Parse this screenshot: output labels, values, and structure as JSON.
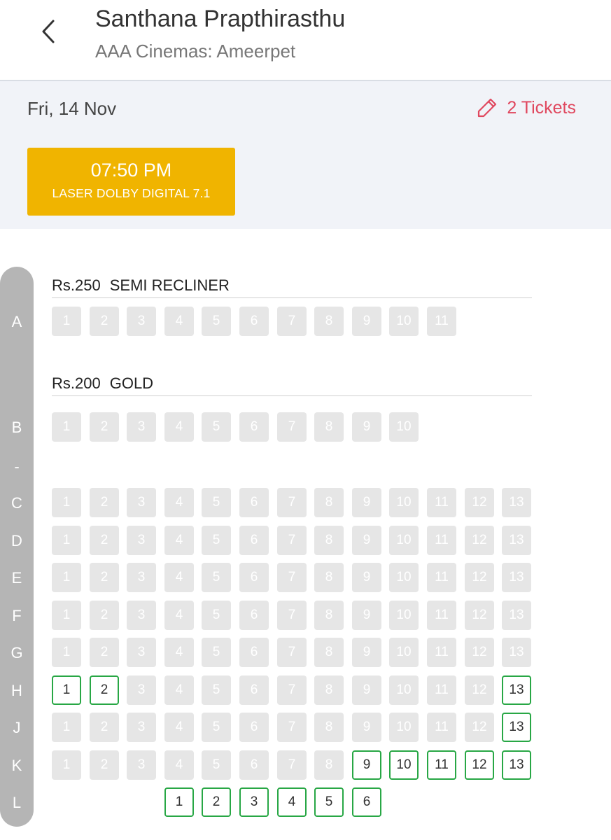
{
  "header": {
    "title": "Santhana Prapthirasthu",
    "subtitle": "AAA Cinemas: Ameerpet",
    "back_icon": "back-arrow-icon"
  },
  "booking": {
    "date": "Fri, 14 Nov",
    "tickets_label": "2 Tickets",
    "edit_icon": "pencil-icon",
    "showtime": {
      "time": "07:50 PM",
      "format": "LASER DOLBY DIGITAL 7.1"
    }
  },
  "colors": {
    "accent_red": "#e0475e",
    "showtime_bg": "#f0b400",
    "available_border": "#28a745",
    "unavailable_bg": "#e6e6e6"
  },
  "sections": [
    {
      "price": "Rs.250",
      "name": "SEMI RECLINER"
    },
    {
      "price": "Rs.200",
      "name": "GOLD"
    }
  ],
  "row_labels": [
    "A",
    "B",
    "-",
    "C",
    "D",
    "E",
    "F",
    "G",
    "H",
    "J",
    "K",
    "L"
  ],
  "seat_rows": [
    {
      "row": "A",
      "section": 0,
      "seats": [
        {
          "n": "1",
          "s": "u"
        },
        {
          "n": "2",
          "s": "u"
        },
        {
          "n": "3",
          "s": "u"
        },
        {
          "n": "4",
          "s": "u"
        },
        {
          "n": "5",
          "s": "u"
        },
        {
          "n": "6",
          "s": "u"
        },
        {
          "n": "7",
          "s": "u"
        },
        {
          "n": "8",
          "s": "u"
        },
        {
          "n": "9",
          "s": "u"
        },
        {
          "n": "10",
          "s": "u"
        },
        {
          "n": "11",
          "s": "u"
        }
      ]
    },
    {
      "row": "B",
      "section": 1,
      "seats": [
        {
          "n": "1",
          "s": "u"
        },
        {
          "n": "2",
          "s": "u"
        },
        {
          "n": "3",
          "s": "u"
        },
        {
          "n": "4",
          "s": "u"
        },
        {
          "n": "5",
          "s": "u"
        },
        {
          "n": "6",
          "s": "u"
        },
        {
          "n": "7",
          "s": "u"
        },
        {
          "n": "8",
          "s": "u"
        },
        {
          "n": "9",
          "s": "u"
        },
        {
          "n": "10",
          "s": "u"
        }
      ]
    },
    {
      "row": "C",
      "section": 1,
      "seats": [
        {
          "n": "1",
          "s": "u"
        },
        {
          "n": "2",
          "s": "u"
        },
        {
          "n": "3",
          "s": "u"
        },
        {
          "n": "4",
          "s": "u"
        },
        {
          "n": "5",
          "s": "u"
        },
        {
          "n": "6",
          "s": "u"
        },
        {
          "n": "7",
          "s": "u"
        },
        {
          "n": "8",
          "s": "u"
        },
        {
          "n": "9",
          "s": "u"
        },
        {
          "n": "10",
          "s": "u"
        },
        {
          "n": "11",
          "s": "u"
        },
        {
          "n": "12",
          "s": "u"
        },
        {
          "n": "13",
          "s": "u"
        }
      ]
    },
    {
      "row": "D",
      "section": 1,
      "seats": [
        {
          "n": "1",
          "s": "u"
        },
        {
          "n": "2",
          "s": "u"
        },
        {
          "n": "3",
          "s": "u"
        },
        {
          "n": "4",
          "s": "u"
        },
        {
          "n": "5",
          "s": "u"
        },
        {
          "n": "6",
          "s": "u"
        },
        {
          "n": "7",
          "s": "u"
        },
        {
          "n": "8",
          "s": "u"
        },
        {
          "n": "9",
          "s": "u"
        },
        {
          "n": "10",
          "s": "u"
        },
        {
          "n": "11",
          "s": "u"
        },
        {
          "n": "12",
          "s": "u"
        },
        {
          "n": "13",
          "s": "u"
        }
      ]
    },
    {
      "row": "E",
      "section": 1,
      "seats": [
        {
          "n": "1",
          "s": "u"
        },
        {
          "n": "2",
          "s": "u"
        },
        {
          "n": "3",
          "s": "u"
        },
        {
          "n": "4",
          "s": "u"
        },
        {
          "n": "5",
          "s": "u"
        },
        {
          "n": "6",
          "s": "u"
        },
        {
          "n": "7",
          "s": "u"
        },
        {
          "n": "8",
          "s": "u"
        },
        {
          "n": "9",
          "s": "u"
        },
        {
          "n": "10",
          "s": "u"
        },
        {
          "n": "11",
          "s": "u"
        },
        {
          "n": "12",
          "s": "u"
        },
        {
          "n": "13",
          "s": "u"
        }
      ]
    },
    {
      "row": "F",
      "section": 1,
      "seats": [
        {
          "n": "1",
          "s": "u"
        },
        {
          "n": "2",
          "s": "u"
        },
        {
          "n": "3",
          "s": "u"
        },
        {
          "n": "4",
          "s": "u"
        },
        {
          "n": "5",
          "s": "u"
        },
        {
          "n": "6",
          "s": "u"
        },
        {
          "n": "7",
          "s": "u"
        },
        {
          "n": "8",
          "s": "u"
        },
        {
          "n": "9",
          "s": "u"
        },
        {
          "n": "10",
          "s": "u"
        },
        {
          "n": "11",
          "s": "u"
        },
        {
          "n": "12",
          "s": "u"
        },
        {
          "n": "13",
          "s": "u"
        }
      ]
    },
    {
      "row": "G",
      "section": 1,
      "seats": [
        {
          "n": "1",
          "s": "u"
        },
        {
          "n": "2",
          "s": "u"
        },
        {
          "n": "3",
          "s": "u"
        },
        {
          "n": "4",
          "s": "u"
        },
        {
          "n": "5",
          "s": "u"
        },
        {
          "n": "6",
          "s": "u"
        },
        {
          "n": "7",
          "s": "u"
        },
        {
          "n": "8",
          "s": "u"
        },
        {
          "n": "9",
          "s": "u"
        },
        {
          "n": "10",
          "s": "u"
        },
        {
          "n": "11",
          "s": "u"
        },
        {
          "n": "12",
          "s": "u"
        },
        {
          "n": "13",
          "s": "u"
        }
      ]
    },
    {
      "row": "H",
      "section": 1,
      "seats": [
        {
          "n": "1",
          "s": "a"
        },
        {
          "n": "2",
          "s": "a"
        },
        {
          "n": "3",
          "s": "u"
        },
        {
          "n": "4",
          "s": "u"
        },
        {
          "n": "5",
          "s": "u"
        },
        {
          "n": "6",
          "s": "u"
        },
        {
          "n": "7",
          "s": "u"
        },
        {
          "n": "8",
          "s": "u"
        },
        {
          "n": "9",
          "s": "u"
        },
        {
          "n": "10",
          "s": "u"
        },
        {
          "n": "11",
          "s": "u"
        },
        {
          "n": "12",
          "s": "u"
        },
        {
          "n": "13",
          "s": "a"
        }
      ]
    },
    {
      "row": "J",
      "section": 1,
      "seats": [
        {
          "n": "1",
          "s": "u"
        },
        {
          "n": "2",
          "s": "u"
        },
        {
          "n": "3",
          "s": "u"
        },
        {
          "n": "4",
          "s": "u"
        },
        {
          "n": "5",
          "s": "u"
        },
        {
          "n": "6",
          "s": "u"
        },
        {
          "n": "7",
          "s": "u"
        },
        {
          "n": "8",
          "s": "u"
        },
        {
          "n": "9",
          "s": "u"
        },
        {
          "n": "10",
          "s": "u"
        },
        {
          "n": "11",
          "s": "u"
        },
        {
          "n": "12",
          "s": "u"
        },
        {
          "n": "13",
          "s": "a"
        }
      ]
    },
    {
      "row": "K",
      "section": 1,
      "seats": [
        {
          "n": "1",
          "s": "u"
        },
        {
          "n": "2",
          "s": "u"
        },
        {
          "n": "3",
          "s": "u"
        },
        {
          "n": "4",
          "s": "u"
        },
        {
          "n": "5",
          "s": "u"
        },
        {
          "n": "6",
          "s": "u"
        },
        {
          "n": "7",
          "s": "u"
        },
        {
          "n": "8",
          "s": "u"
        },
        {
          "n": "9",
          "s": "a"
        },
        {
          "n": "10",
          "s": "a"
        },
        {
          "n": "11",
          "s": "a"
        },
        {
          "n": "12",
          "s": "a"
        },
        {
          "n": "13",
          "s": "a"
        }
      ]
    },
    {
      "row": "L",
      "section": 1,
      "offset": 3,
      "seats": [
        {
          "n": "1",
          "s": "a"
        },
        {
          "n": "2",
          "s": "a"
        },
        {
          "n": "3",
          "s": "a"
        },
        {
          "n": "4",
          "s": "a"
        },
        {
          "n": "5",
          "s": "a"
        },
        {
          "n": "6",
          "s": "a"
        }
      ]
    }
  ]
}
